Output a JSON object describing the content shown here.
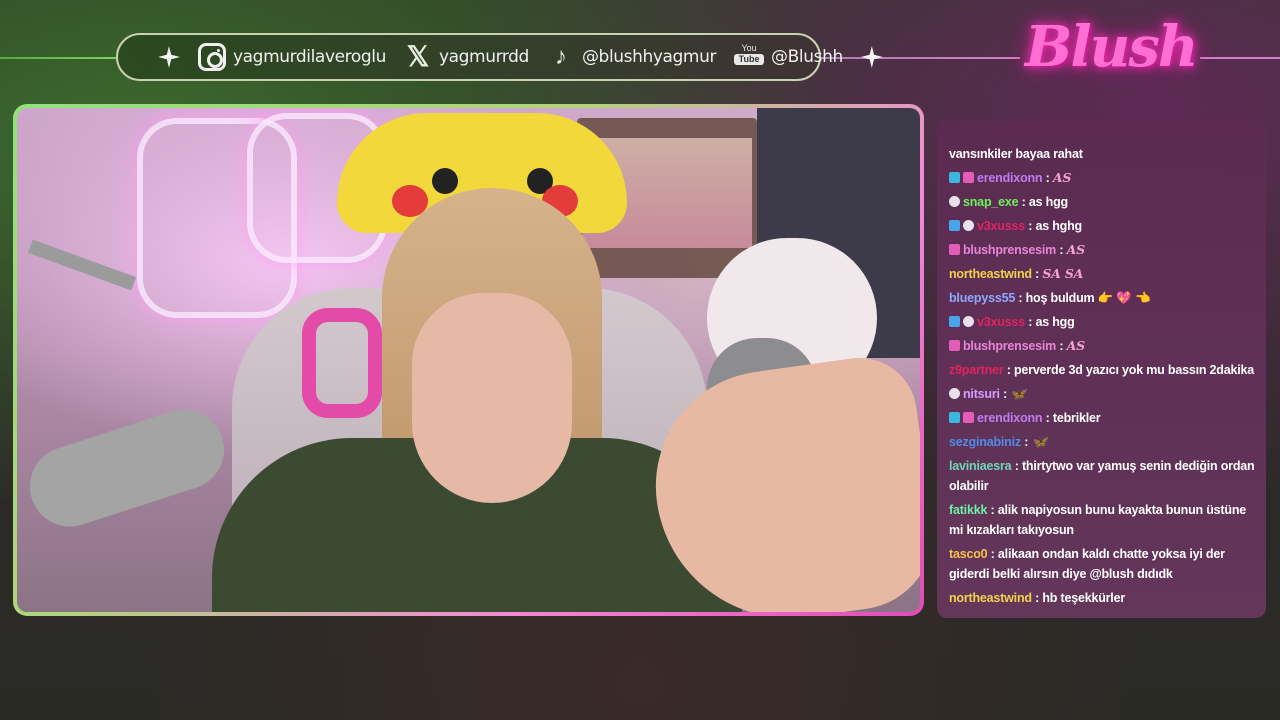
{
  "socials": [
    {
      "icon": "instagram-icon",
      "handle": "yagmurdilaveroglu"
    },
    {
      "icon": "x-icon",
      "glyph": "𝕏",
      "handle": "yagmurrdd"
    },
    {
      "icon": "tiktok-icon",
      "glyph": "♪",
      "handle": "@blushhyagmur"
    },
    {
      "icon": "youtube-icon",
      "you": "You",
      "tube": "Tube",
      "handle": "@Blushh"
    }
  ],
  "logo": "Blush",
  "chat": {
    "messages": [
      {
        "user": "",
        "color": "#ffffff",
        "badges": [],
        "text": "vansınkiler bayaa rahat"
      },
      {
        "user": "erendixonn",
        "color": "#c07cf0",
        "badges": [
          "b-blue",
          "b-pink"
        ],
        "text": "",
        "emote": "AS"
      },
      {
        "user": "snap_exe",
        "color": "#6cf05e",
        "badges": [
          "b-white"
        ],
        "text": "as hgg"
      },
      {
        "user": "v3xusss",
        "color": "#e0245e",
        "badges": [
          "b-cube",
          "b-white"
        ],
        "text": "as hghg"
      },
      {
        "user": "blushprensesim",
        "color": "#e985d8",
        "badges": [
          "b-pink"
        ],
        "text": "",
        "emote": "AS"
      },
      {
        "user": "northeastwind",
        "color": "#f2d14d",
        "badges": [],
        "text": "",
        "emote": "SA  SA"
      },
      {
        "user": "bluepyss55",
        "color": "#8ea8ff",
        "badges": [],
        "text": "hoş buldum 👉 💖 👈"
      },
      {
        "user": "v3xusss",
        "color": "#e0245e",
        "badges": [
          "b-cube",
          "b-white"
        ],
        "text": "as hgg"
      },
      {
        "user": "blushprensesim",
        "color": "#e985d8",
        "badges": [
          "b-pink"
        ],
        "text": "",
        "emote": "AS"
      },
      {
        "user": "z9partner",
        "color": "#e0245e",
        "badges": [],
        "text": "perverde 3d yazıcı yok mu bassın 2dakika"
      },
      {
        "user": "nitsuri",
        "color": "#d79bff",
        "badges": [
          "b-white"
        ],
        "text": "",
        "emote": "🦋"
      },
      {
        "user": "erendixonn",
        "color": "#c07cf0",
        "badges": [
          "b-blue",
          "b-pink"
        ],
        "text": "tebrikler"
      },
      {
        "user": "sezginabiniz",
        "color": "#4e8ce8",
        "badges": [],
        "text": "",
        "emote": "🦋"
      },
      {
        "user": "laviniaesra",
        "color": "#6fd6b4",
        "badges": [],
        "text": "thirtytwo var yamuş senin dediğin ordan olabilir"
      },
      {
        "user": "fatikkk",
        "color": "#6ff0a8",
        "badges": [],
        "text": "alik napiyosun bunu kayakta bunun üstüne mi kızakları takıyosun"
      },
      {
        "user": "tasco0",
        "color": "#f4c14a",
        "badges": [],
        "text": "alikaan ondan kaldı chatte yoksa iyi der giderdi belki alırsın diye @blush dıdıdk"
      },
      {
        "user": "northeastwind",
        "color": "#f2d14d",
        "badges": [],
        "text": "hb teşekkürler"
      }
    ]
  }
}
